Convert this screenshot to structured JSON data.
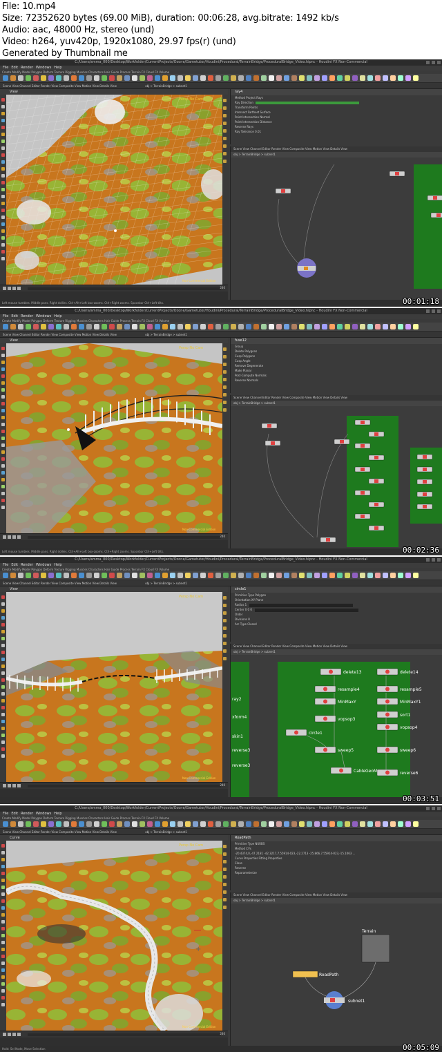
{
  "header": {
    "file": "File: 10.mp4",
    "size": "Size: 72352620 bytes (69.00 MiB), duration: 00:06:28, avg.bitrate: 1492 kb/s",
    "audio": "Audio: aac, 48000 Hz, stereo (und)",
    "video": "Video: h264, yuv420p, 1920x1080, 29.97 fps(r) (und)",
    "generated": "Generated by Thumbnail me"
  },
  "app": {
    "window_title": "C:/Users/amma_000/Desktop/Workfolder/CurrentProjects/Ozone/Gametutor/Houdini/Procedural/TerrainBridge/ProceduralBridge_Video.hipnc - Houdini FX Non-Commercial",
    "menu": [
      "File",
      "Edit",
      "Render",
      "Windows",
      "Help"
    ],
    "shelf_tabs": "Create  Modify  Model  Polygon  Deform  Texture  Rigging  Muscles  Characters  Hair  Guide Process  Terrain FX  Cloud FX  Volume",
    "path_tabs": "Scene View   Channel Editor   Render View   Composite View   Motion View   Details View",
    "path": "obj  >  TerrainBridge  >  subnet1",
    "timeline_end": "240",
    "non_commercial": "Non-Commercial Edition",
    "accent": "#3c9a3c",
    "network_green": "#1e7a1e"
  },
  "frames": [
    {
      "timestamp": "00:01:18",
      "viewport_title": "View",
      "node_name": "ray4",
      "param_rows": [
        "Method   Project Rays",
        "Ray Direction",
        "Transform Points",
        "Intersect Farthest Surface",
        "Point Intersection Normal",
        "Point Intersection Distance",
        "Reverse Rays",
        "Ray Tolerance  0.01"
      ],
      "status": "Left mouse tumbles. Middle pans. Right dollies. Ctrl+Alt+Left box-zooms. Ctrl+Right zooms. Spacebar Ctrl+Left tilts.",
      "network_nodes": []
    },
    {
      "timestamp": "00:02:36",
      "viewport_title": "View",
      "node_name": "fuse12",
      "param_rows": [
        "Group",
        "Delete Polygons",
        "Cusp Polygons",
        "Cusp Angle",
        "Remove Degenerate",
        "Make Planar",
        "Post-Compute Normals",
        "Reverse Normals"
      ],
      "status": "Left mouse tumbles. Middle pans. Right dollies. Ctrl+Alt+Left box-zooms. Ctrl+Right zooms. Spacebar Ctrl+Left tilts.",
      "network_nodes": []
    },
    {
      "timestamp": "00:03:51",
      "viewport_title": "View",
      "node_name": "circle1",
      "param_rows": [
        "Primitive Type   Polygon",
        "Orientation   XY Plane",
        "Radius   1",
        "Center   0   0   0",
        "Order",
        "Divisions   8",
        "Arc Type   Closed"
      ],
      "status": "",
      "network_nodes": [
        "delete13",
        "delete14",
        "resample4",
        "resample5",
        "MinMaxY",
        "MinMaxY1",
        "sort1",
        "vopsop3",
        "vopsop4",
        "circle1",
        "sweep5",
        "sweep6",
        "CableGeoMerge",
        "reverse6",
        "ray2",
        "xform4",
        "skin1",
        "reverse3"
      ]
    },
    {
      "timestamp": "00:05:09",
      "viewport_title": "Curve",
      "node_name": "RoadPath",
      "param_rows": [
        "Primitive Type   NURBS",
        "Method   CVs",
        "-20.4374,0,-47.2181 -42.3217,7.55914-023,-22.2713 -25.866,7.55914-023,-15.1063 ...",
        "Curve Properties   Fitting Properties",
        "Close",
        "Reverse",
        "Reparameterize"
      ],
      "status": "Hold: Sel Node, Move Selection",
      "network_nodes": [
        "Terrain",
        "RoadPath",
        "subnet1"
      ]
    }
  ]
}
